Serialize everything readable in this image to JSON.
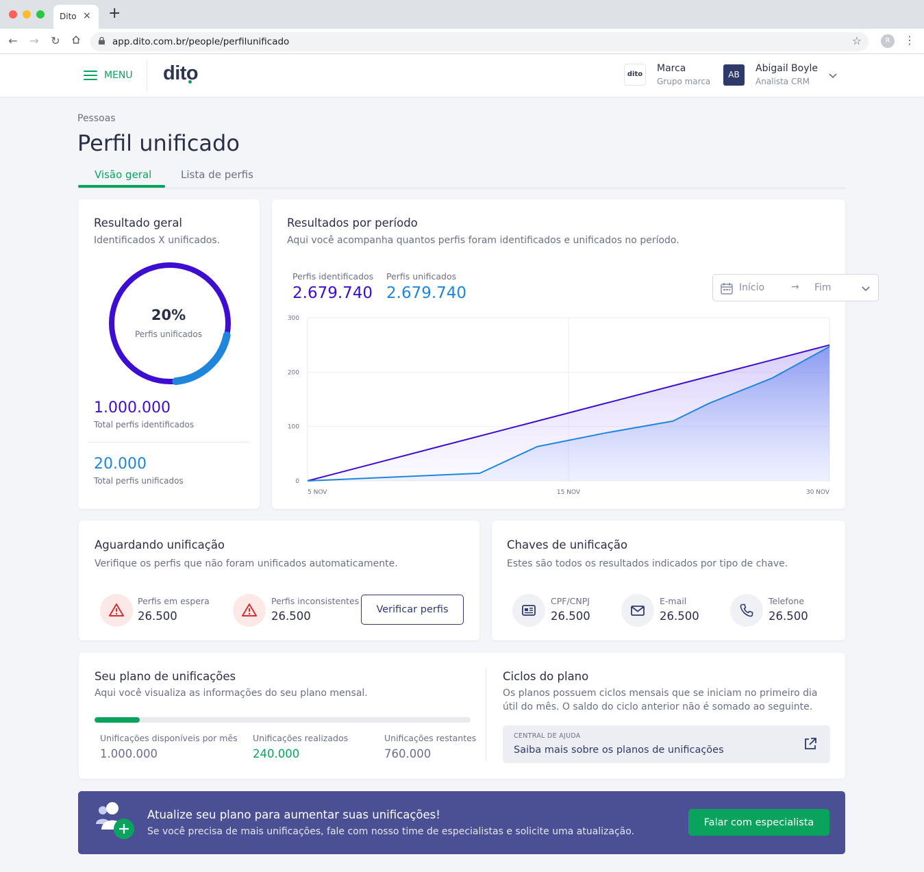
{
  "browser": {
    "tab_title": "Dito",
    "tab_close": "×",
    "new_tab": "+",
    "url": "app.dito.com.br/people/perfilunificado",
    "profile_initial": "R"
  },
  "header": {
    "menu_label": "MENU",
    "logo_text": "dito",
    "brand_logo_text": "dito",
    "brand_name": "Marca",
    "brand_group": "Grupo marca",
    "avatar_initials": "AB",
    "user_name": "Abigail Boyle",
    "user_role": "Analista CRM"
  },
  "page": {
    "breadcrumb": "Pessoas",
    "title": "Perfil unificado",
    "tabs": [
      {
        "label": "Visão geral",
        "active": true
      },
      {
        "label": "Lista de perfis",
        "active": false
      }
    ]
  },
  "resultado_geral": {
    "title": "Resultado geral",
    "subtitle": "Identificados X unificados.",
    "percent_label": "20%",
    "percent_value": 0.2,
    "percent_caption": "Perfis unificados",
    "total_identified": "1.000.000",
    "total_identified_label": "Total perfis identificados",
    "total_unified": "20.000",
    "total_unified_label": "Total perfis unificados"
  },
  "resultados_periodo": {
    "title": "Resultados por período",
    "subtitle": "Aqui você acompanha quantos perfis foram identificados e unificados no período.",
    "kpis": [
      {
        "label": "Perfis identificados",
        "value": "2.679.740"
      },
      {
        "label": "Perfis unificados",
        "value": "2.679.740"
      }
    ],
    "date_start_placeholder": "Início",
    "date_end_placeholder": "Fim"
  },
  "chart_data": {
    "type": "area",
    "x_tick_labels": [
      "5 NOV",
      "15 NOV",
      "30 NOV"
    ],
    "ylim": [
      0,
      300
    ],
    "y_ticks": [
      0,
      100,
      200,
      300
    ],
    "grid": true,
    "series": [
      {
        "name": "Perfis identificados",
        "color": "#3d0dd1",
        "x": [
          0,
          1
        ],
        "y": [
          0,
          250
        ]
      },
      {
        "name": "Perfis unificados",
        "color": "#1f86db",
        "x": [
          0,
          0.33,
          0.44,
          0.57,
          0.7,
          0.77,
          0.89,
          1
        ],
        "y": [
          0,
          14,
          63,
          88,
          110,
          143,
          189,
          247
        ]
      }
    ]
  },
  "aguardando": {
    "title": "Aguardando unificação",
    "subtitle": "Verifique os perfis que não foram unificados automaticamente.",
    "stats": [
      {
        "label": "Perfis em espera",
        "value": "26.500",
        "icon": "warning-icon"
      },
      {
        "label": "Perfis inconsistentes",
        "value": "26.500",
        "icon": "warning-icon"
      }
    ],
    "button": "Verificar perfis"
  },
  "chaves": {
    "title": "Chaves de unificação",
    "subtitle": "Estes são todos os resultados indicados por tipo de chave.",
    "stats": [
      {
        "label": "CPF/CNPJ",
        "value": "26.500",
        "icon": "id-card-icon"
      },
      {
        "label": "E-mail",
        "value": "26.500",
        "icon": "mail-icon"
      },
      {
        "label": "Telefone",
        "value": "26.500",
        "icon": "phone-icon"
      }
    ]
  },
  "plano": {
    "title": "Seu plano de unificações",
    "subtitle": "Aqui você visualiza as informações do seu plano mensal.",
    "progress_fraction": 0.12,
    "columns": [
      {
        "label": "Unificações disponíveis por mês",
        "value": "1.000.000"
      },
      {
        "label": "Unificações realizados",
        "value": "240.000"
      },
      {
        "label": "Unificações restantes",
        "value": "760.000"
      }
    ],
    "cycles_title": "Ciclos do plano",
    "cycles_text_line1": "Os planos possuem ciclos mensais que se iniciam no primeiro dia",
    "cycles_text_line2": "útil do mês. O saldo do ciclo anterior não é somado ao seguinte.",
    "help_kicker": "CENTRAL DE AJUDA",
    "help_link": "Saiba mais sobre os planos de unificações"
  },
  "banner": {
    "title": "Atualize seu plano para aumentar suas unificações!",
    "text": "Se você precisa de mais unificações, fale com nosso time de especialistas e solicite uma atualização.",
    "button": "Falar com especialista"
  },
  "colors": {
    "accent_green": "#0aa35e",
    "purple": "#3d0dd1",
    "blue": "#1f86db",
    "navy": "#2f3a6b",
    "banner": "#4b5094"
  }
}
